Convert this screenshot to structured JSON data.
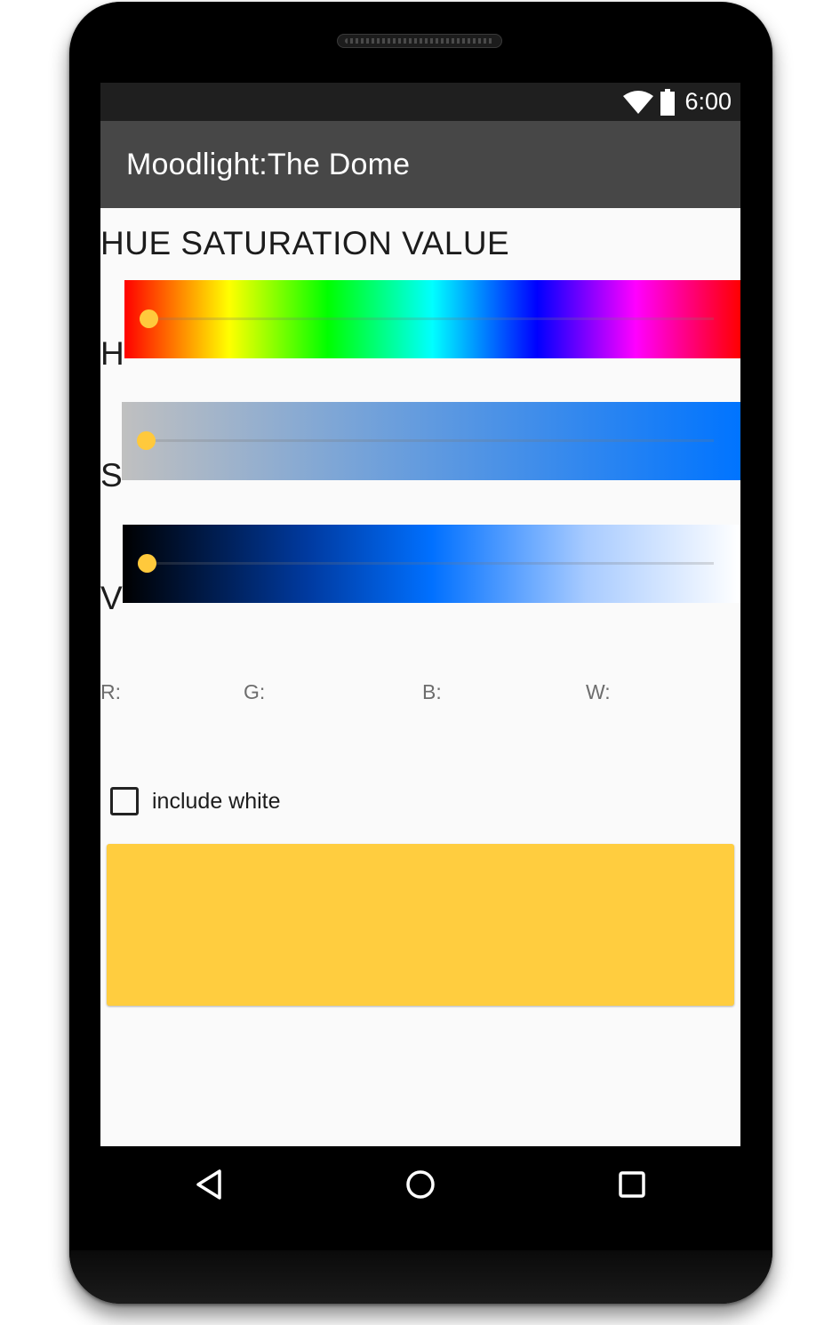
{
  "status_bar": {
    "time": "6:00",
    "icons": [
      "wifi-icon",
      "battery-icon"
    ]
  },
  "app_bar": {
    "title": "Moodlight:The Dome"
  },
  "hsv": {
    "title": "HUE SATURATION VALUE",
    "sliders": [
      {
        "label": "H",
        "value_fraction": 0.0
      },
      {
        "label": "S",
        "value_fraction": 0.0
      },
      {
        "label": "V",
        "value_fraction": 0.0
      }
    ]
  },
  "rgbw": {
    "r_label": "R:",
    "g_label": "G:",
    "b_label": "B:",
    "w_label": "W:"
  },
  "include_white": {
    "label": "include white",
    "checked": false
  },
  "preview": {
    "color": "#ffcd3f"
  },
  "colors": {
    "thumb": "#ffc93c",
    "app_bar": "#474747",
    "status_bar": "#1f1f1f",
    "screen_bg": "#fafafa"
  },
  "nav": {
    "buttons": [
      "back-icon",
      "home-icon",
      "recents-icon"
    ]
  }
}
